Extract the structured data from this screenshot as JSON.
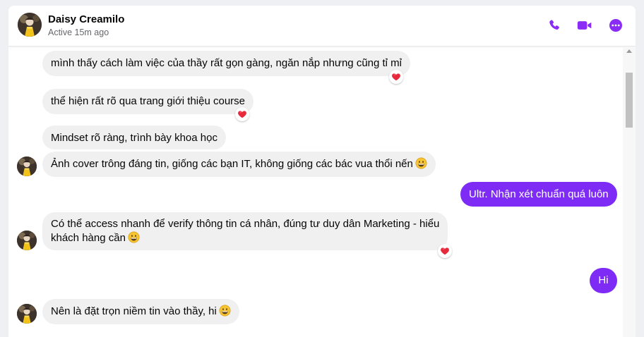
{
  "header": {
    "name": "Daisy Creamilo",
    "status": "Active 15m ago",
    "accent": "#8a2cf5"
  },
  "messages": [
    {
      "side": "in",
      "text": "mình thấy cách làm việc của thầy rất gọn gàng, ngăn nắp nhưng cũng tỉ mỉ",
      "reaction": "heart"
    },
    {
      "side": "in",
      "text": "thể hiện rất rõ qua trang giới thiệu course",
      "reaction": "heart"
    },
    {
      "side": "in",
      "text": "Mindset rõ ràng, trình bày khoa học"
    },
    {
      "side": "in",
      "text": "Ảnh cover trông đáng tin, giống các bạn IT, không giống các bác vua thổi nến",
      "emoji": "grin-emoji"
    },
    {
      "side": "out",
      "text": "Ultr. Nhận xét chuẩn quá luôn"
    },
    {
      "side": "in",
      "text_line1": "Có thể access nhanh để verify thông tin cá nhân, đúng tư duy dân Marketing - hiểu",
      "text_line2": "khách hàng cần",
      "emoji": "grin-emoji",
      "reaction": "heart"
    },
    {
      "side": "out",
      "text": "Hi"
    },
    {
      "side": "in",
      "text": "Nên là đặt trọn niềm tin vào thầy, hi",
      "emoji": "grin-emoji"
    }
  ],
  "colors": {
    "incoming_bubble": "#f0f0f0",
    "outgoing_bubble": "#7e2cf5",
    "heart": "#e8283b"
  }
}
